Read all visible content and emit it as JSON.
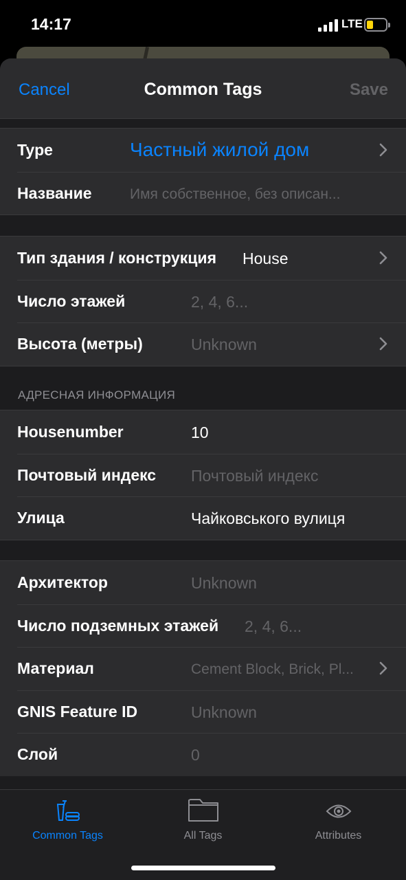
{
  "status": {
    "time": "14:17",
    "network": "LTE"
  },
  "nav": {
    "cancel": "Cancel",
    "title": "Common Tags",
    "save": "Save"
  },
  "general": {
    "type_label": "Type",
    "type_value": "Частный жилой дом",
    "name_label": "Название",
    "name_placeholder": "Имя собственное, без описан..."
  },
  "building": {
    "kind_label": "Тип здания / конструкция",
    "kind_value": "House",
    "levels_label": "Число этажей",
    "levels_placeholder": "2, 4, 6...",
    "height_label": "Высота (метры)",
    "height_placeholder": "Unknown"
  },
  "address": {
    "header": "АДРЕСНАЯ ИНФОРМАЦИЯ",
    "housenumber_label": "Housenumber",
    "housenumber_value": "10",
    "postcode_label": "Почтовый индекс",
    "postcode_placeholder": "Почтовый индекс",
    "street_label": "Улица",
    "street_value": "Чайковського вулиця"
  },
  "extra": {
    "architect_label": "Архитектор",
    "architect_placeholder": "Unknown",
    "underground_label": "Число подземных этажей",
    "underground_placeholder": "2, 4, 6...",
    "material_label": "Материал",
    "material_placeholder": "Cement Block, Brick, Pl...",
    "gnis_label": "GNIS Feature ID",
    "gnis_placeholder": "Unknown",
    "layer_label": "Слой",
    "layer_placeholder": "0"
  },
  "tabs": [
    {
      "label": "Common Tags",
      "icon": "common-tags-icon",
      "active": true
    },
    {
      "label": "All Tags",
      "icon": "folder-icon",
      "active": false
    },
    {
      "label": "Attributes",
      "icon": "eye-icon",
      "active": false
    }
  ],
  "colors": {
    "accent": "#0a84ff",
    "background": "#1c1c1e",
    "cell": "#2c2c2e",
    "placeholder": "#636366"
  }
}
